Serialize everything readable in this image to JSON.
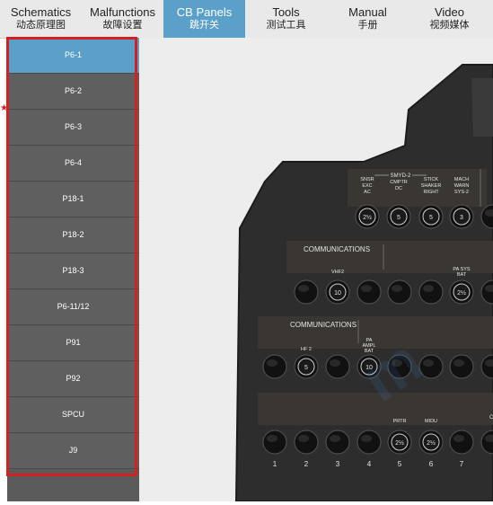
{
  "tabs": [
    {
      "en": "Schematics",
      "zh": "动态原理图"
    },
    {
      "en": "Malfunctions",
      "zh": "故障设置"
    },
    {
      "en": "CB Panels",
      "zh": "跳开关"
    },
    {
      "en": "Tools",
      "zh": "测试工具"
    },
    {
      "en": "Manual",
      "zh": "手册"
    },
    {
      "en": "Video",
      "zh": "视频媒体"
    }
  ],
  "active_tab": "CB Panels",
  "sidebar": {
    "items": [
      "P6-1",
      "P6-2",
      "P6-3",
      "P6-4",
      "P18-1",
      "P18-2",
      "P18-3",
      "P6-11/12",
      "P91",
      "P92",
      "SPCU",
      "J9"
    ],
    "active": "P6-1"
  },
  "panel": {
    "smyd_group": "SMYD-2",
    "top_labels": [
      {
        "lines": [
          "SNSR",
          "EXC",
          "AC"
        ],
        "rating": "2½"
      },
      {
        "lines": [
          "CMPTR",
          "DC"
        ],
        "rating": "5"
      },
      {
        "lines": [
          "STICK",
          "SHAKER",
          "RIGHT"
        ],
        "rating": "5"
      },
      {
        "lines": [
          "MACH",
          "WARN",
          "SYS-2"
        ],
        "rating": "3"
      }
    ],
    "comm_label_1": "COMMUNICATIONS",
    "comm_label_2": "COMMUNICATIONS",
    "row2_labels": [
      {
        "lines": [
          "VHF2"
        ],
        "rating": "10"
      },
      {
        "lines": [
          "PA SYS",
          "BAT"
        ],
        "rating": "2½"
      }
    ],
    "row3_labels": [
      {
        "lines": [
          "HF 2"
        ],
        "rating": "5"
      },
      {
        "lines": [
          "PA",
          "AMPL",
          "BAT"
        ],
        "rating": "10"
      }
    ],
    "row4_labels": [
      {
        "lines": [
          "PRTR"
        ],
        "rating": "2½"
      },
      {
        "lines": [
          "MIDU"
        ],
        "rating": "2½"
      }
    ],
    "column_numbers": [
      "1",
      "2",
      "3",
      "4",
      "5",
      "6",
      "7"
    ],
    "edge_label": "C"
  },
  "colors": {
    "accent": "#5aa0c8",
    "highlight": "#d62020",
    "panel": "#2b2b2b",
    "sidebar": "#5f5f5f"
  }
}
